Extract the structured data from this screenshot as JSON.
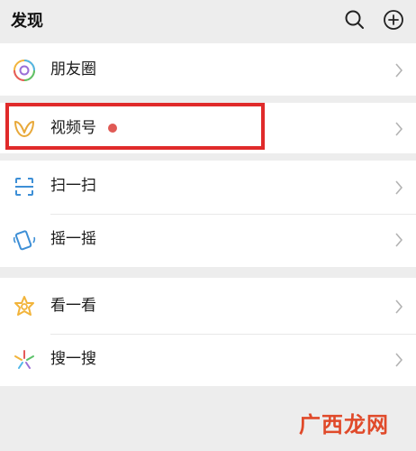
{
  "header": {
    "title": "发现"
  },
  "items": [
    {
      "label": "朋友圈"
    },
    {
      "label": "视频号"
    },
    {
      "label": "扫一扫"
    },
    {
      "label": "摇一摇"
    },
    {
      "label": "看一看"
    },
    {
      "label": "搜一搜"
    }
  ],
  "watermark": "广西龙网",
  "colors": {
    "background": "#ededed",
    "card": "#ffffff",
    "highlight_border": "#e02a2a",
    "badge_dot": "#e05a55"
  },
  "icons": [
    "search-icon",
    "add-icon",
    "moments-icon",
    "channels-icon",
    "scan-icon",
    "shake-icon",
    "top-stories-icon",
    "search-feature-icon",
    "chevron-right-icon"
  ]
}
